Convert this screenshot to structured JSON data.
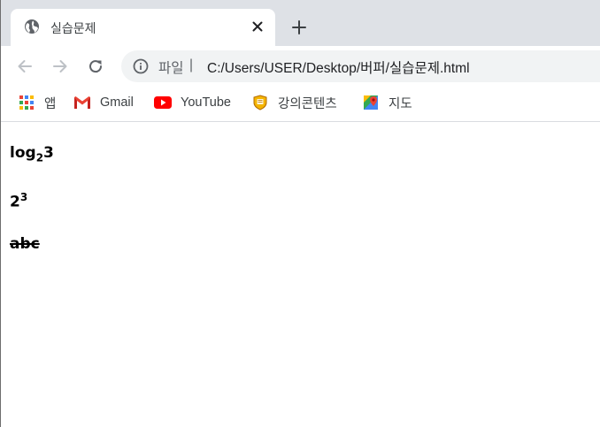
{
  "tab": {
    "title": "실습문제"
  },
  "toolbar": {
    "scheme_label": "파일",
    "separator": "|",
    "url": "C:/Users/USER/Desktop/버퍼/실습문제.html"
  },
  "bookmarks": [
    {
      "label": "앱",
      "icon": "apps-grid-icon"
    },
    {
      "label": "Gmail",
      "icon": "gmail-icon"
    },
    {
      "label": "YouTube",
      "icon": "youtube-icon"
    },
    {
      "label": "강의콘텐츠",
      "icon": "shield-badge-icon"
    },
    {
      "label": "지도",
      "icon": "maps-icon"
    }
  ],
  "content": {
    "line1": {
      "base": "log",
      "sub": "2",
      "after": "3"
    },
    "line2": {
      "base": "2",
      "sup": "3"
    },
    "line3": {
      "text": "abc"
    }
  },
  "colors": {
    "tabstrip": "#dee1e6",
    "omnibox": "#f1f3f4",
    "youtube_red": "#ff0000",
    "gmail_red": "#ea4335"
  }
}
